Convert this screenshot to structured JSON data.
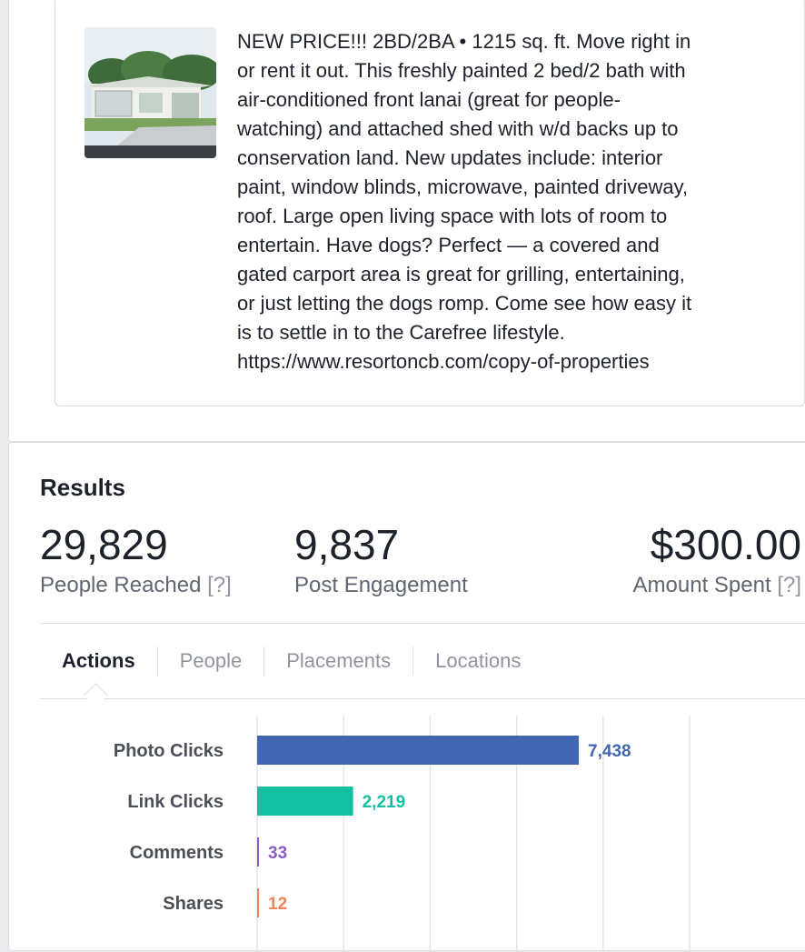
{
  "post": {
    "lines": [
      "NEW PRICE!!! 2BD/2BA • 1215 sq. ft. Move right in",
      "or rent it out. This freshly painted 2 bed/2 bath with",
      "air-conditioned front lanai (great for people-",
      "watching) and attached shed with w/d backs up to",
      "conservation land. New updates include: interior",
      "paint, window blinds, microwave, painted driveway,",
      "roof. Large open living space with lots of room to",
      "entertain. Have dogs? Perfect — a covered and",
      "gated carport area is great for grilling, entertaining,",
      "or just letting the dogs romp. Come see how easy it",
      "is to settle in to the Carefree lifestyle.",
      "https://www.resortoncb.com/copy-of-properties"
    ]
  },
  "results": {
    "title": "Results",
    "metrics": [
      {
        "value": "29,829",
        "label": "People Reached",
        "help": "[?]"
      },
      {
        "value": "9,837",
        "label": "Post Engagement",
        "help": ""
      },
      {
        "value": "$300.00",
        "label": "Amount Spent",
        "help": "[?]"
      }
    ]
  },
  "tabs": [
    "Actions",
    "People",
    "Placements",
    "Locations"
  ],
  "chart_data": {
    "type": "bar",
    "orientation": "horizontal",
    "categories": [
      "Photo Clicks",
      "Link Clicks",
      "Comments",
      "Shares"
    ],
    "values": [
      7438,
      2219,
      33,
      12
    ],
    "value_labels": [
      "7,438",
      "2,219",
      "33",
      "12"
    ],
    "colors": [
      "#4267b2",
      "#14bfa2",
      "#8c5cc8",
      "#f0845a"
    ],
    "xlim": [
      0,
      10000
    ],
    "grid": true
  }
}
